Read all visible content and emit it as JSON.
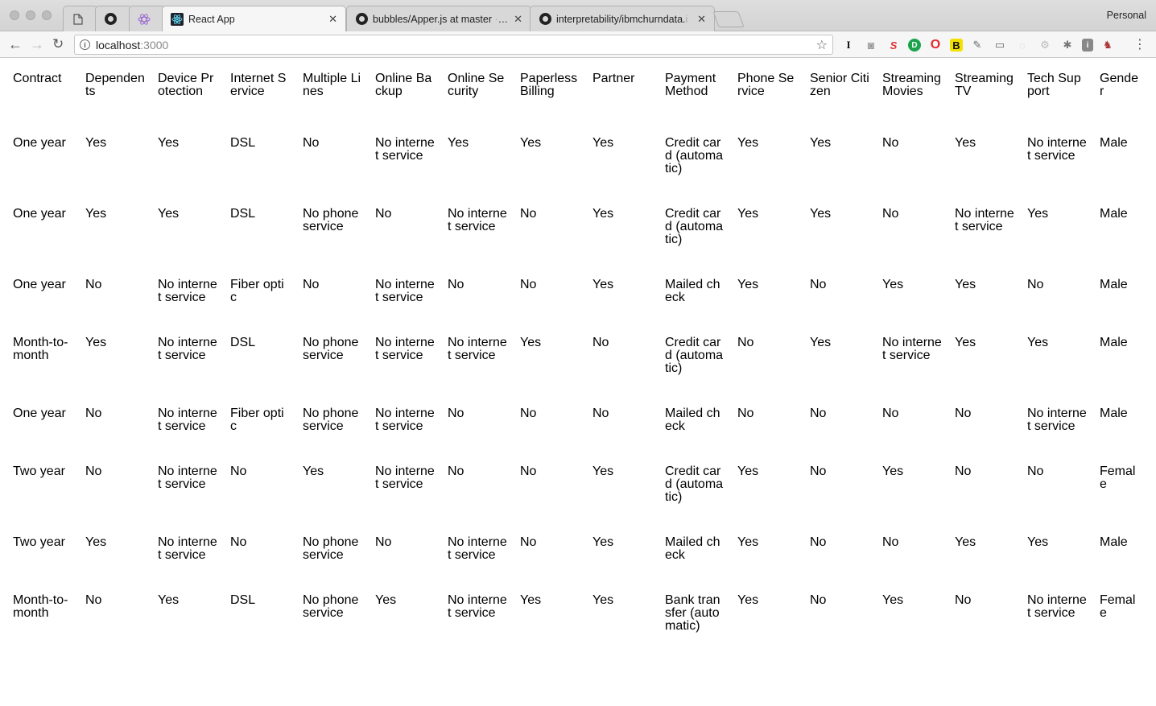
{
  "browser": {
    "tabs": [
      {
        "title": "",
        "icon": "document-icon",
        "active": false
      },
      {
        "title": "",
        "icon": "github-icon",
        "active": false
      },
      {
        "title": "",
        "icon": "atom-icon",
        "active": false
      },
      {
        "title": "React App",
        "icon": "react-icon",
        "active": true
      },
      {
        "title": "bubbles/Apper.js at master",
        "suffix": " · fa",
        "icon": "github-icon",
        "active": false
      },
      {
        "title": "interpretability/ibmchurndata.",
        "suffix": "i",
        "icon": "github-icon",
        "active": false
      }
    ],
    "profile_label": "Personal",
    "url": {
      "host": "localhost",
      "port": ":3000"
    }
  },
  "table": {
    "headers": [
      "Contract",
      "Dependents",
      "DeviceProtection",
      "InternetService",
      "MultipleLines",
      "OnlineBackup",
      "OnlineSecurity",
      "PaperlessBilling",
      "Partner",
      "PaymentMethod",
      "PhoneService",
      "SeniorCitizen",
      "StreamingMovies",
      "StreamingTV",
      "TechSupport",
      "Gender"
    ],
    "header_display": [
      "Contract",
      "Dependents",
      "Device Protection",
      "Internet Service",
      "Multiple Lines",
      "Online Backup",
      "Online Security",
      "Paperless Billing",
      "Partner",
      "Payment Method",
      "Phone Service",
      "Senior Citizen",
      "Streaming Movies",
      "Streaming TV",
      "Tech Support",
      "Gender"
    ],
    "rows": [
      [
        "One year",
        "Yes",
        "Yes",
        "DSL",
        "No",
        "No internet service",
        "Yes",
        "Yes",
        "Yes",
        "Credit card (automatic)",
        "Yes",
        "Yes",
        "No",
        "Yes",
        "No internet service",
        "Male"
      ],
      [
        "One year",
        "Yes",
        "Yes",
        "DSL",
        "No phone service",
        "No",
        "No internet service",
        "No",
        "Yes",
        "Credit card (automatic)",
        "Yes",
        "Yes",
        "No",
        "No internet service",
        "Yes",
        "Male"
      ],
      [
        "One year",
        "No",
        "No internet service",
        "Fiber optic",
        "No",
        "No internet service",
        "No",
        "No",
        "Yes",
        "Mailed check",
        "Yes",
        "No",
        "Yes",
        "Yes",
        "No",
        "Male"
      ],
      [
        "Month-to-month",
        "Yes",
        "No internet service",
        "DSL",
        "No phone service",
        "No internet service",
        "No internet service",
        "Yes",
        "No",
        "Credit card (automatic)",
        "No",
        "Yes",
        "No internet service",
        "Yes",
        "Yes",
        "Male"
      ],
      [
        "One year",
        "No",
        "No internet service",
        "Fiber optic",
        "No phone service",
        "No internet service",
        "No",
        "No",
        "No",
        "Mailed check",
        "No",
        "No",
        "No",
        "No",
        "No internet service",
        "Male"
      ],
      [
        "Two year",
        "No",
        "No internet service",
        "No",
        "Yes",
        "No internet service",
        "No",
        "No",
        "Yes",
        "Credit card (automatic)",
        "Yes",
        "No",
        "Yes",
        "No",
        "No",
        "Female"
      ],
      [
        "Two year",
        "Yes",
        "No internet service",
        "No",
        "No phone service",
        "No",
        "No internet service",
        "No",
        "Yes",
        "Mailed check",
        "Yes",
        "No",
        "No",
        "Yes",
        "Yes",
        "Male"
      ],
      [
        "Month-to-month",
        "No",
        "Yes",
        "DSL",
        "No phone service",
        "Yes",
        "No internet service",
        "Yes",
        "Yes",
        "Bank transfer (automatic)",
        "Yes",
        "No",
        "Yes",
        "No",
        "No internet service",
        "Female"
      ]
    ]
  }
}
